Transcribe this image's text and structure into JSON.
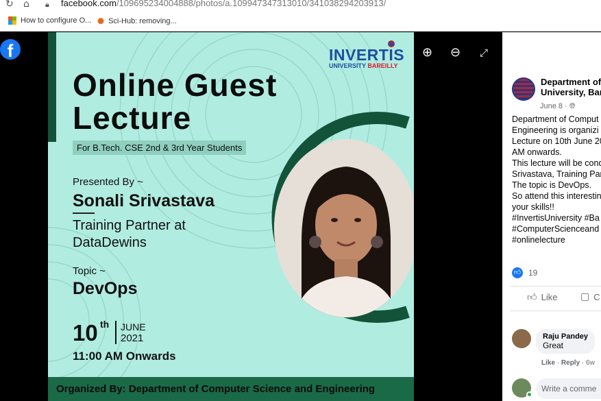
{
  "browser": {
    "url_host": "facebook.com",
    "url_path": "/109695234004888/photos/a.109947347313010/341038294203913/",
    "bookmarks": [
      "How to configure O...",
      "Sci-Hub: removing..."
    ]
  },
  "viewer": {
    "brand_logo": "facebook-logo",
    "tools": [
      "zoom-in-icon",
      "zoom-out-icon",
      "fullscreen-icon"
    ]
  },
  "poster": {
    "brand_name": "INVERTIS",
    "brand_sub_1": "UNIVERSITY ",
    "brand_sub_2": "BAREILLY",
    "title_line1": "Online Guest",
    "title_line2": "Lecture",
    "audience": "For B.Tech. CSE 2nd & 3rd Year Students",
    "presented_by": "Presented By ~",
    "presenter": "Sonali Srivastava",
    "role_line1": "Training Partner at",
    "role_line2": "DataDewins",
    "topic_label": "Topic ~",
    "topic": "DevOps",
    "day": "10",
    "day_suffix": "th",
    "month": "JUNE",
    "year": "2021",
    "time": "11:00 AM Onwards",
    "organizer": "Organized By: Department of Computer Science and Engineering",
    "colors": {
      "background": "#b1ece0",
      "accent": "#13533a"
    }
  },
  "post": {
    "author_line1": "Department of",
    "author_line2": "University, Bare",
    "date": "June 8 · ",
    "text_lines": [
      "Department of Comput",
      "Engineering is organizi",
      "Lecture on 10th June 20",
      "AM onwards.",
      "This lecture will be cond",
      "Srivastava, Training Part",
      "The topic is DevOps.",
      "So attend this interestin",
      "your skills!!",
      "#InvertisUniversity #Ba",
      "#ComputerScienceand",
      "#onlinelecture"
    ],
    "like_count": "19",
    "like_label": "Like",
    "comment_label": "C",
    "comment": {
      "name": "Raju Pandey",
      "text": "Great",
      "like": "Like",
      "reply": "Reply",
      "age": "6w"
    },
    "write_placeholder": "Write a comme"
  }
}
